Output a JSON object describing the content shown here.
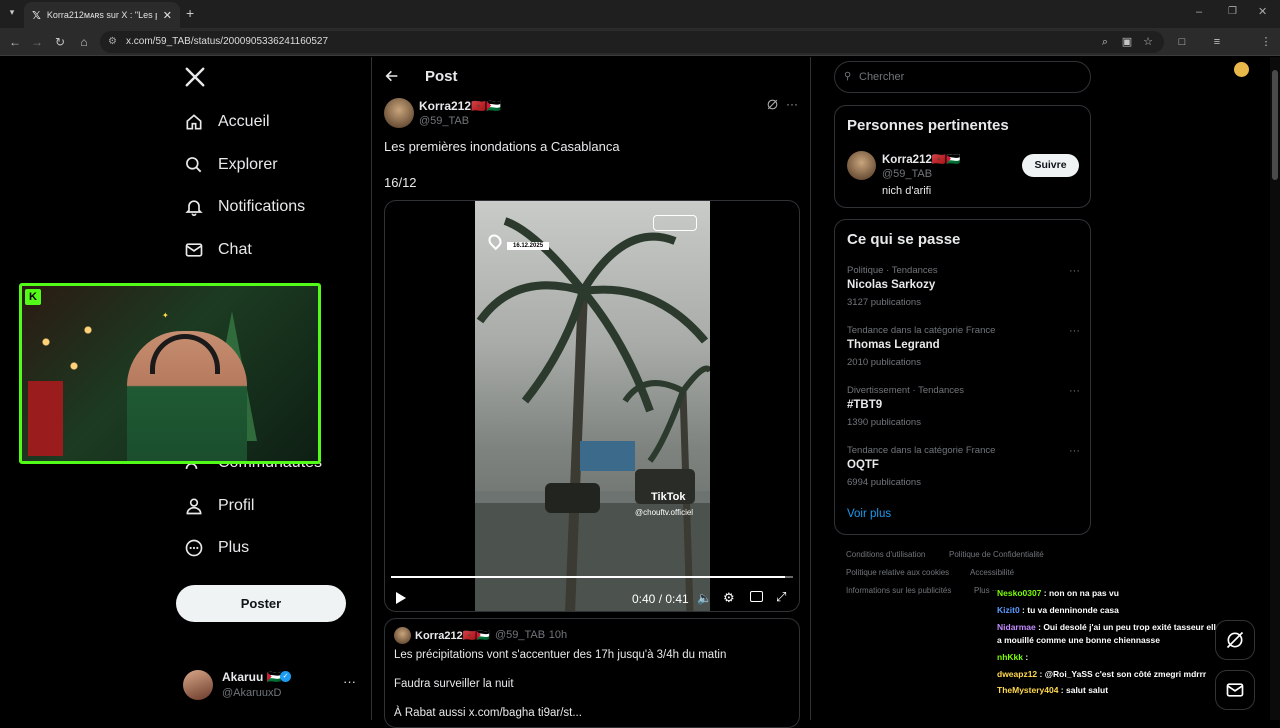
{
  "browser": {
    "tab_title": "Korra212ᴍᴀʀs sur X : \"Les premi",
    "url": "x.com/59_TAB/status/2000905336241160527"
  },
  "nav": {
    "items": [
      {
        "label": "Accueil",
        "icon": "home-icon"
      },
      {
        "label": "Explorer",
        "icon": "search-icon"
      },
      {
        "label": "Notifications",
        "icon": "bell-icon"
      },
      {
        "label": "Chat",
        "icon": "mail-icon"
      },
      {
        "label": "Communautés",
        "icon": "people-icon"
      },
      {
        "label": "Profil",
        "icon": "person-icon"
      },
      {
        "label": "Plus",
        "icon": "more-circle-icon"
      }
    ],
    "post_button": "Poster",
    "account": {
      "name": "Akaruu 🇵🇸",
      "handle": "@AkaruuxD"
    }
  },
  "post": {
    "header": "Post",
    "author_name": "Korra212🇲🇦🇵🇸",
    "author_handle": "@59_TAB",
    "text": "Les premières inondations a Casablanca",
    "date_line": "16/12",
    "video": {
      "stamp": "16.12.2025",
      "time": "0:40 / 0:41",
      "progress": 0.98,
      "watermark": "TikTok",
      "watermark_user": "@chouftv.officiel"
    }
  },
  "quote": {
    "author_name": "Korra212🇲🇦🇵🇸",
    "author_handle": "@59_TAB",
    "time": "· 10h",
    "line1": "Les précipitations vont s'accentuer des 17h jusqu'à 3/4h du matin",
    "line2": "Faudra surveiller la nuit",
    "line3": "À Rabat aussi  x.com/bagha ti9ar/st..."
  },
  "sidebar": {
    "search_placeholder": "Chercher",
    "relevant": {
      "title": "Personnes pertinentes",
      "name": "Korra212🇲🇦🇵🇸",
      "handle": "@59_TAB",
      "bio": "nich d'arifi",
      "follow": "Suivre"
    },
    "trends": {
      "title": "Ce qui se passe",
      "items": [
        {
          "category": "Politique · Tendances",
          "name": "Nicolas Sarkozy",
          "count": "3127 publications"
        },
        {
          "category": "Tendance dans la catégorie France",
          "name": "Thomas Legrand",
          "count": "2010 publications"
        },
        {
          "category": "Divertissement · Tendances",
          "name": "#TBT9",
          "count": "1390 publications"
        },
        {
          "category": "Tendance dans la catégorie France",
          "name": "OQTF",
          "count": "6994 publications"
        }
      ],
      "see_more": "Voir plus"
    },
    "footer": {
      "l1a": "Conditions d'utilisation",
      "l1b": "Politique de Confidentialité",
      "l2a": "Politique relative aux cookies",
      "l2b": "Accessibilité",
      "l3a": "Informations sur les publicités",
      "l3b": "Plus ···"
    }
  },
  "chat": {
    "messages": [
      {
        "user": "Nesko0307",
        "text": ": non on na pas vu",
        "color": "#7cfc00"
      },
      {
        "user": "Kizit0",
        "text": ": tu va denninonde casa",
        "color": "#5b9bff"
      },
      {
        "user": "Nidarmae",
        "text": ": Oui desolé j'ai un peu trop exité tasseur elle",
        "color": "#c28cff"
      },
      {
        "user": "",
        "text": "a mouillé comme une bonne chiennasse",
        "color": "#ffffff"
      },
      {
        "user": "nhKkk",
        "text": ":",
        "color": "#7cfc00"
      },
      {
        "user": "dweapz12",
        "text": ": @Roi_YaSS c'est son côté zmegri mdrrr",
        "color": "#ffd84d"
      },
      {
        "user": "TheMystery404",
        "text": ": salut salut",
        "color": "#ffd84d"
      }
    ]
  },
  "colors": {
    "accent": "#1d9bf0",
    "kick": "#53fc18",
    "background": "#000000",
    "border": "#2f3336"
  }
}
